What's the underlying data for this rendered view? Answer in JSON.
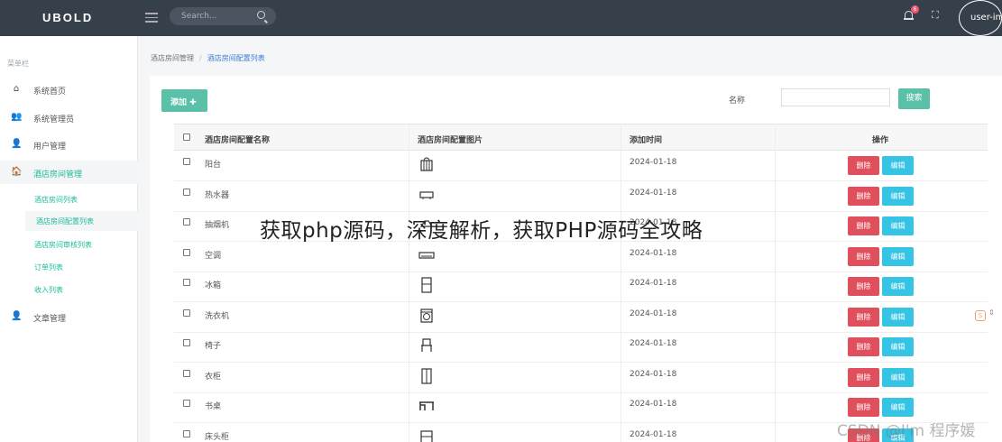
{
  "brand": {
    "logo": "UBOLD"
  },
  "topbar": {
    "search_placeholder": "Search...",
    "notification_count": "6",
    "user": "user-img"
  },
  "sidebar": {
    "caption": "菜单栏",
    "items": [
      {
        "label": "系统首页",
        "icon": "home-icon"
      },
      {
        "label": "系统管理员",
        "icon": "users-icon"
      },
      {
        "label": "用户管理",
        "icon": "user-icon"
      },
      {
        "label": "酒店房间管理",
        "icon": "home-filled-icon"
      },
      {
        "label": "文章管理",
        "icon": "user-icon"
      }
    ],
    "subitems": [
      "酒店房间列表",
      "酒店房间配置列表",
      "酒店房间审核列表",
      "订单列表",
      "收入列表"
    ]
  },
  "breadcrumb": {
    "parent": "酒店房间管理",
    "current": "酒店房间配置列表"
  },
  "toolbar": {
    "add_label": "添加",
    "name_label": "名称",
    "search_label": "搜索"
  },
  "table": {
    "headers": [
      "酒店房间配置名称",
      "酒店房间配置图片",
      "添加时间",
      "操作"
    ],
    "rows": [
      {
        "name": "阳台",
        "date": "2024-01-18",
        "icon": "balcony-icon"
      },
      {
        "name": "热水器",
        "date": "2024-01-18",
        "icon": "water-heater-icon"
      },
      {
        "name": "抽烟机",
        "date": "2024-01-18",
        "icon": "range-hood-icon"
      },
      {
        "name": "空调",
        "date": "2024-01-18",
        "icon": "air-conditioner-icon"
      },
      {
        "name": "冰箱",
        "date": "2024-01-18",
        "icon": "fridge-icon"
      },
      {
        "name": "洗衣机",
        "date": "2024-01-18",
        "icon": "washing-machine-icon"
      },
      {
        "name": "椅子",
        "date": "2024-01-18",
        "icon": "chair-icon"
      },
      {
        "name": "衣柜",
        "date": "2024-01-18",
        "icon": "wardrobe-icon"
      },
      {
        "name": "书桌",
        "date": "2024-01-18",
        "icon": "desk-icon"
      },
      {
        "name": "床头柜",
        "date": "2024-01-18",
        "icon": "nightstand-icon"
      }
    ],
    "delete_label": "删除",
    "edit_label": "编辑"
  },
  "overlay": {
    "title": "获取php源码，深度解析，获取PHP源码全攻略",
    "watermark": "CSDN @I'm 程序媛"
  },
  "colors": {
    "topbar": "#36404a",
    "accent": "#1abc9c",
    "danger": "#e0505c",
    "info": "#35c4e4"
  }
}
